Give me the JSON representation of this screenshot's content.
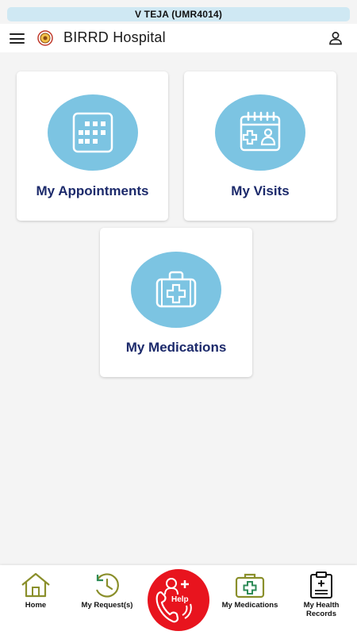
{
  "user_banner": "V TEJA (UMR4014)",
  "app_bar": {
    "title": "BIRRD Hospital"
  },
  "cards": {
    "appointments": "My Appointments",
    "visits": "My Visits",
    "medications": "My Medications"
  },
  "bottom_nav": {
    "home": "Home",
    "requests": "My Request(s)",
    "help": "Help",
    "medications": "My Medications",
    "health_records_line1": "My Health",
    "health_records_line2": "Records"
  },
  "colors": {
    "circle": "#7cc4e2",
    "card_label": "#1c2a6b",
    "help_red": "#e8141e",
    "banner": "#cfe8f3"
  }
}
